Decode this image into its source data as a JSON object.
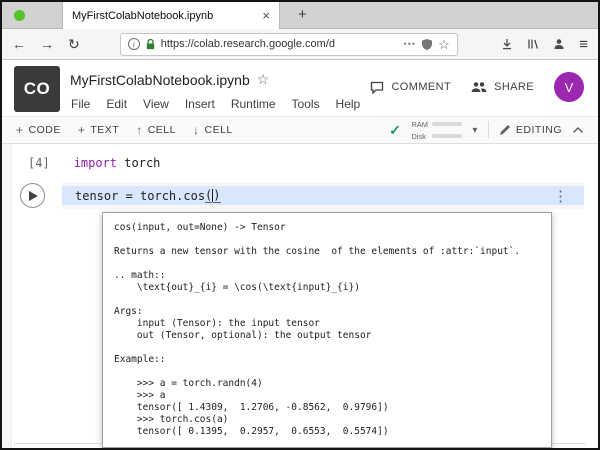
{
  "browser": {
    "tab_title": "MyFirstColabNotebook.ipynb",
    "url": "https://colab.research.google.com/d"
  },
  "icons": {
    "back": "←",
    "forward": "→",
    "reload": "↻",
    "info": "i",
    "page_actions": "•••",
    "bookmark_star": "☆",
    "hamburger": "≡",
    "close_tab": "×",
    "new_tab": "+",
    "title_star": "☆",
    "check": "✓",
    "caret_down": "▾",
    "plus": "+",
    "arrow_up": "↑",
    "arrow_down": "↓",
    "kebab": "⋮"
  },
  "header": {
    "logo": "CO",
    "title": "MyFirstColabNotebook.ipynb",
    "comment_label": "COMMENT",
    "share_label": "SHARE",
    "avatar_initial": "V"
  },
  "menu": {
    "items": [
      "File",
      "Edit",
      "View",
      "Insert",
      "Runtime",
      "Tools",
      "Help"
    ]
  },
  "toolbar": {
    "code_label": "CODE",
    "text_label": "TEXT",
    "cell_up_label": "CELL",
    "cell_down_label": "CELL",
    "ram_label": "RAM",
    "disk_label": "Disk",
    "editing_label": "EDITING"
  },
  "notebook": {
    "cell1_exec_count": "[4]",
    "cell1_keyword": "import",
    "cell1_code_rest": " torch",
    "cell2_code": "tensor = torch.cos",
    "cell2_paren_open": "(",
    "cell2_paren_close": ")",
    "tooltip_text": "cos(input, out=None) -> Tensor\n\nReturns a new tensor with the cosine  of the elements of :attr:`input`.\n\n.. math::\n    \\text{out}_{i} = \\cos(\\text{input}_{i})\n\nArgs:\n    input (Tensor): the input tensor\n    out (Tensor, optional): the output tensor\n\nExample::\n\n    >>> a = torch.randn(4)\n    >>> a\n    tensor([ 1.4309,  1.2706, -0.8562,  0.9796])\n    >>> torch.cos(a)\n    tensor([ 0.1395,  0.2957,  0.6553,  0.5574])"
  },
  "colors": {
    "selection_blue": "#d9e7fd",
    "keyword_purple": "#8e24aa",
    "avatar_purple": "#9c27b0",
    "check_green": "#0f9d58",
    "lock_green": "#2e7d32"
  }
}
